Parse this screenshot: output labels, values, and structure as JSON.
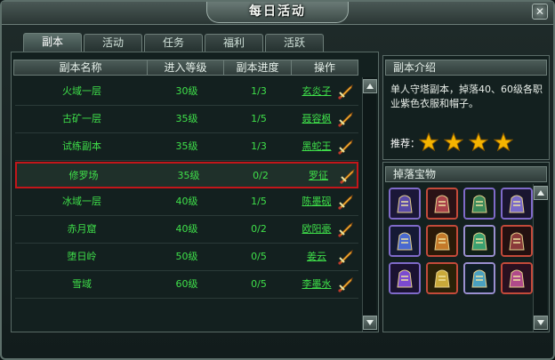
{
  "window": {
    "title": "每日活动",
    "close_label": "✕"
  },
  "tabs": [
    {
      "label": "副本",
      "active": true
    },
    {
      "label": "活动",
      "active": false
    },
    {
      "label": "任务",
      "active": false
    },
    {
      "label": "福利",
      "active": false
    },
    {
      "label": "活跃",
      "active": false
    }
  ],
  "table": {
    "headers": [
      "副本名称",
      "进入等级",
      "副本进度",
      "操作"
    ],
    "rows": [
      {
        "name": "火域一层",
        "level": "30级",
        "progress": "1/3",
        "boss": "玄炎子"
      },
      {
        "name": "古矿一层",
        "level": "35级",
        "progress": "1/5",
        "boss": "聂容枫"
      },
      {
        "name": "试练副本",
        "level": "35级",
        "progress": "1/3",
        "boss": "黑蛇王"
      },
      {
        "name": "修罗场",
        "level": "35级",
        "progress": "0/2",
        "boss": "罗征",
        "selected": true
      },
      {
        "name": "冰域一层",
        "level": "40级",
        "progress": "1/5",
        "boss": "陈墨砚"
      },
      {
        "name": "赤月窟",
        "level": "40级",
        "progress": "0/2",
        "boss": "欧阳豪"
      },
      {
        "name": "堕日岭",
        "level": "50级",
        "progress": "0/5",
        "boss": "姜云"
      },
      {
        "name": "雪域",
        "level": "60级",
        "progress": "0/5",
        "boss": "李墨水"
      }
    ]
  },
  "intro": {
    "title": "副本介绍",
    "text": "单人守塔副本，掉落40、60级各职业紫色衣服和帽子。",
    "rating_label": "推荐：",
    "rating": 4
  },
  "drops": {
    "title": "掉落宝物",
    "item_count": 12
  },
  "colors": {
    "accent_green": "#3fe04a",
    "selected_border": "#c3161a",
    "star": "#f5b400"
  }
}
